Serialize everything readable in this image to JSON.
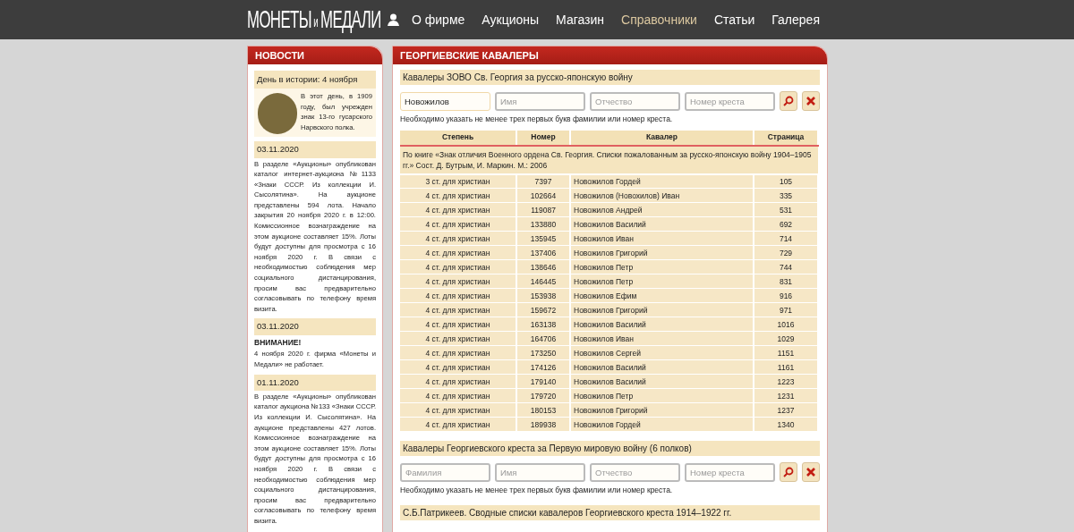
{
  "logo": {
    "left": "МОНЕТЫ",
    "middle": "и",
    "right": "МЕДАЛИ"
  },
  "nav": [
    {
      "label": "О фирме",
      "selected": false
    },
    {
      "label": "Аукционы",
      "selected": false
    },
    {
      "label": "Магазин",
      "selected": false
    },
    {
      "label": "Справочники",
      "selected": true
    },
    {
      "label": "Статьи",
      "selected": false
    },
    {
      "label": "Галерея",
      "selected": false
    }
  ],
  "news": {
    "title": "НОВОСТИ",
    "history": {
      "title": "День в истории: 4 ноября",
      "text": "В этот день, в 1909 году, был учрежден знак 13-го гусарского Нарвского полка."
    },
    "items": [
      {
        "date": "03.11.2020",
        "text": "В разделе «Аукционы» опубликован каталог интернет-аукциона №1133 «Знаки СССР. Из коллекции И. Сысолятина». На аукционе представлены 594 лота. Начало закрытия 20 ноября 2020 г. в 12:00. Комиссионное вознаграждение на этом аукционе составляет 15%. Лоты будут доступны для просмотра с 16 ноября 2020 г. В связи с необходимостью соблюдения мер социального дистанцирования, просим вас предварительно согласовывать по телефону время визита."
      },
      {
        "date": "03.11.2020",
        "heading": "ВНИМАНИЕ!",
        "text": "4 ноября 2020 г. фирма «Монеты и Медали» не работает."
      },
      {
        "date": "01.11.2020",
        "text": "В разделе «Аукционы» опубликован каталог аукциона №133 «Знаки СССР. Из коллекции И. Сысолятина». На аукционе представлены 427 лотов. Комиссионное вознаграждение на этом аукционе составляет 15%. Лоты будут доступны для просмотра с 16 ноября 2020 г. В связи с необходимостью соблюдения мер социального дистанцирования, просим вас предварительно согласовывать по телефону время визита."
      }
    ]
  },
  "main": {
    "title": "ГЕОРГИЕВСКИЕ КАВАЛЕРЫ",
    "sections": [
      {
        "title": "Кавалеры ЗОВО Св. Георгия за русско-японскую войну",
        "fields": [
          {
            "value": "Новожилов"
          },
          {
            "placeholder": "Имя"
          },
          {
            "placeholder": "Отчество"
          },
          {
            "placeholder": "Номер креста"
          }
        ],
        "hint": "Необходимо указать не менее трех первых букв фамилии или номер креста.",
        "table": {
          "columns": [
            "Степень",
            "Номер",
            "Кавалер",
            "Страница"
          ],
          "source": "По книге «Знак отличия Военного ордена Св. Георгия. Списки пожалованным за русско-японскую войну 1904–1905 гг.» Сост. Д. Бутрым, И. Маркин. М.: 2006",
          "rows": [
            [
              "3 ст. для христиан",
              "7397",
              "Новожилов Гордей",
              "105"
            ],
            [
              "4 ст. для христиан",
              "102664",
              "Новожилов (Новохилов) Иван",
              "335"
            ],
            [
              "4 ст. для христиан",
              "119087",
              "Новожилов Андрей",
              "531"
            ],
            [
              "4 ст. для христиан",
              "133880",
              "Новожилов Василий",
              "692"
            ],
            [
              "4 ст. для христиан",
              "135945",
              "Новожилов Иван",
              "714"
            ],
            [
              "4 ст. для христиан",
              "137406",
              "Новожилов Григорий",
              "729"
            ],
            [
              "4 ст. для христиан",
              "138646",
              "Новожилов Петр",
              "744"
            ],
            [
              "4 ст. для христиан",
              "146445",
              "Новожилов Петр",
              "831"
            ],
            [
              "4 ст. для христиан",
              "153938",
              "Новожилов Ефим",
              "916"
            ],
            [
              "4 ст. для христиан",
              "159672",
              "Новожилов Григорий",
              "971"
            ],
            [
              "4 ст. для христиан",
              "163138",
              "Новожилов Василий",
              "1016"
            ],
            [
              "4 ст. для христиан",
              "164706",
              "Новожилов Иван",
              "1029"
            ],
            [
              "4 ст. для христиан",
              "173250",
              "Новожилов Сергей",
              "1151"
            ],
            [
              "4 ст. для христиан",
              "174126",
              "Новожилов Василий",
              "1161"
            ],
            [
              "4 ст. для христиан",
              "179140",
              "Новожилов Василий",
              "1223"
            ],
            [
              "4 ст. для христиан",
              "179720",
              "Новожилов Петр",
              "1231"
            ],
            [
              "4 ст. для христиан",
              "180153",
              "Новожилов Григорий",
              "1237"
            ],
            [
              "4 ст. для христиан",
              "189938",
              "Новожилов Гордей",
              "1340"
            ]
          ]
        }
      },
      {
        "title": "Кавалеры Георгиевского креста за Первую мировую войну (6 полков)",
        "fields": [
          {
            "placeholder": "Фамилия"
          },
          {
            "placeholder": "Имя"
          },
          {
            "placeholder": "Отчество"
          },
          {
            "placeholder": "Номер креста"
          }
        ],
        "hint": "Необходимо указать не менее трех первых букв фамилии или номер креста."
      },
      {
        "title": "С.Б.Патрикеев. Сводные списки кавалеров Георгиевского креста 1914–1922 гг."
      }
    ]
  }
}
